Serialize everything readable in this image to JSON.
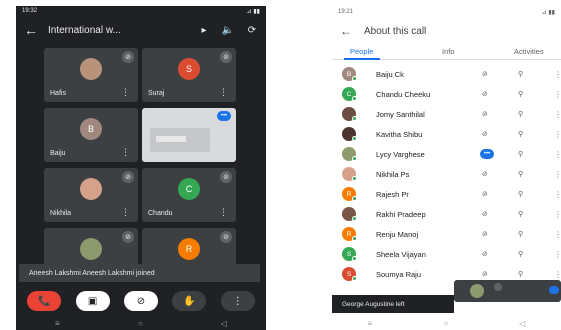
{
  "left": {
    "status": {
      "time": "19:32",
      "right": "⊿ ▮▮"
    },
    "header": {
      "title": "International w...",
      "back": "←",
      "cast": "▸",
      "speaker": "🔈",
      "rotate": "⟳"
    },
    "tiles": [
      {
        "name": "Hafis",
        "initial": "",
        "color": "#b8937a"
      },
      {
        "name": "Suraj",
        "initial": "S",
        "color": "#db4b2f"
      },
      {
        "name": "Baiju",
        "initial": "B",
        "color": "#a1887f"
      },
      {
        "name": "",
        "initial": "",
        "color": ""
      },
      {
        "name": "Nikhila",
        "initial": "",
        "color": "#d6a18a"
      },
      {
        "name": "Chandu",
        "initial": "C",
        "color": "#34a853"
      },
      {
        "name": "",
        "initial": "",
        "color": "#8d9a6e"
      },
      {
        "name": "",
        "initial": "R",
        "color": "#f57c00"
      }
    ],
    "toast": "Aneesh Lakshmi Aneesh Lakshmi joined",
    "controls": {
      "end": "📞",
      "camera": "▣",
      "mic": "⊘",
      "hand": "✋",
      "more": "⋮"
    }
  },
  "right": {
    "status": {
      "time": "19:21",
      "right": "⊿ ▮▮"
    },
    "header": {
      "title": "About this call",
      "back": "←"
    },
    "tabs": [
      "People",
      "Info",
      "Activities"
    ],
    "participants": [
      {
        "name": "Baiju Ck",
        "initial": "B",
        "color": "#a1887f",
        "speaking": false
      },
      {
        "name": "Chandu Cheeku",
        "initial": "C",
        "color": "#34a853",
        "speaking": false
      },
      {
        "name": "Jomy Santhilal",
        "initial": "",
        "color": "#6d4c41",
        "speaking": false
      },
      {
        "name": "Kavitha Shibu",
        "initial": "",
        "color": "#4e342e",
        "speaking": false
      },
      {
        "name": "Lycy Varghese",
        "initial": "",
        "color": "#8d9a6e",
        "speaking": true
      },
      {
        "name": "Nikhila Ps",
        "initial": "",
        "color": "#d6a18a",
        "speaking": false
      },
      {
        "name": "Rajesh Pr",
        "initial": "R",
        "color": "#f57c00",
        "speaking": false
      },
      {
        "name": "Rakhi Pradeep",
        "initial": "",
        "color": "#795548",
        "speaking": false
      },
      {
        "name": "Renju Manoj",
        "initial": "R",
        "color": "#f57c00",
        "speaking": false
      },
      {
        "name": "Sheela Vijayan",
        "initial": "S",
        "color": "#34a853",
        "speaking": false
      },
      {
        "name": "Soumya Raju",
        "initial": "S",
        "color": "#db4b2f",
        "speaking": false
      }
    ],
    "toast": "George Augustine left"
  },
  "colors": {
    "accent": "#1a73e8",
    "end_call": "#ea4335",
    "online": "#34a853"
  }
}
